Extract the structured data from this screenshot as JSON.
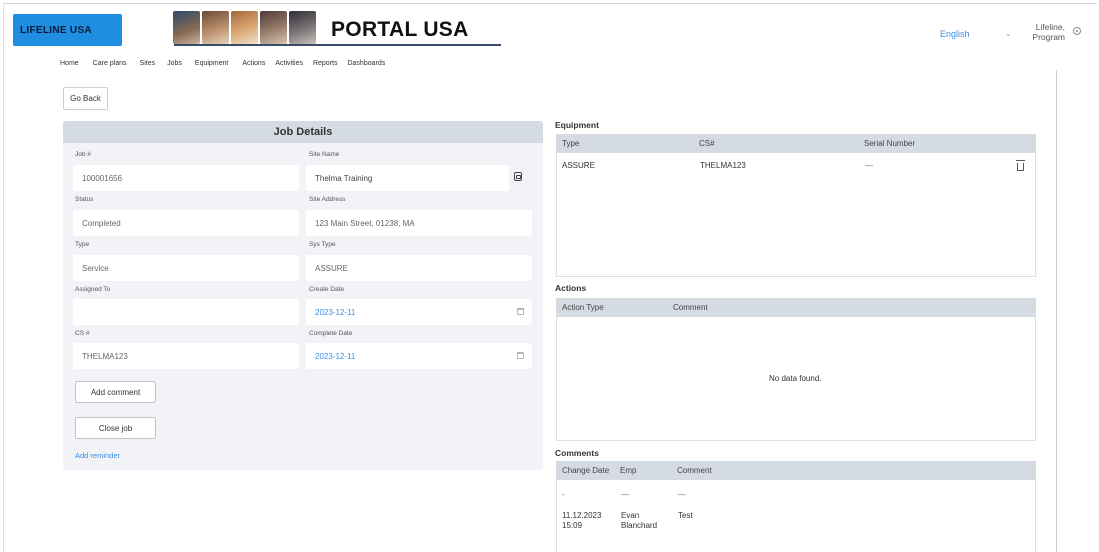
{
  "brand": {
    "logo_text": "LIFELINE USA",
    "portal_title": "PORTAL USA"
  },
  "header": {
    "language": "English",
    "user_line1": "Lifeline,",
    "user_line2": "Program",
    "language_icon": "chevron-down-icon",
    "user_icon": "gear-icon"
  },
  "nav": {
    "items": [
      "Home",
      "Care plans",
      "Sites",
      "Jobs",
      "Equipment",
      "Actions",
      "Activities",
      "Reports",
      "Dashboards"
    ]
  },
  "go_back": "Go Back",
  "job": {
    "title": "Job Details",
    "job_no_label": "Job #",
    "job_no": "100001656",
    "site_name_label": "Site Name",
    "site_name": "Thelma Training",
    "status_label": "Status",
    "status": "Completed",
    "site_address_label": "Site Address",
    "site_address": "123 Main Street, 01238, MA",
    "type_label": "Type",
    "type": "Service",
    "sys_type_label": "Sys Type",
    "sys_type": "ASSURE",
    "assigned_label": "Assigned To",
    "assigned": "",
    "create_date_label": "Create Date",
    "create_date": "2023-12-11",
    "cs_label": "CS #",
    "cs": "THELMA123",
    "complete_date_label": "Complete Date",
    "complete_date": "2023-12-11",
    "add_comment": "Add comment",
    "close_job": "Close job",
    "add_reminder": "Add reminder"
  },
  "equipment": {
    "title": "Equipment",
    "columns": [
      "Type",
      "CS#",
      "Serial Number"
    ],
    "rows": [
      {
        "type": "ASSURE",
        "cs": "THELMA123",
        "serial": "—"
      }
    ]
  },
  "actions": {
    "title": "Actions",
    "columns": [
      "Action Type",
      "Comment"
    ],
    "empty": "No data found."
  },
  "comments": {
    "title": "Comments",
    "columns": [
      "Change Date",
      "Emp",
      "Comment"
    ],
    "rows": [
      {
        "date": "-",
        "emp": "—",
        "comment": "—"
      },
      {
        "date_line1": "11.12.2023",
        "date_line2": "15:09",
        "emp_line1": "Evan",
        "emp_line2": "Blanchard",
        "comment": "Test"
      }
    ]
  },
  "colors": {
    "accent": "#3a8ee6",
    "logo_bg": "#1f8ee0",
    "panel_bg": "#f1f3f6",
    "header_bg": "#d5dbe3"
  }
}
